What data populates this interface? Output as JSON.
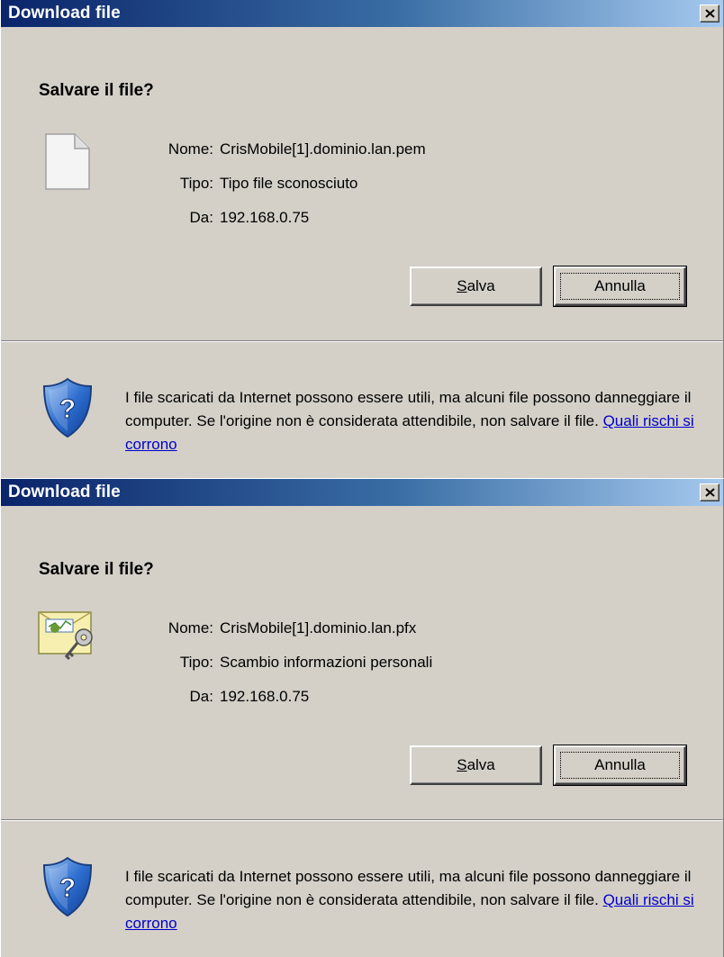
{
  "dialogs": [
    {
      "title": "Download file",
      "question": "Salvare il file?",
      "fields": [
        {
          "label": "Nome:",
          "value": "CrisMobile[1].dominio.lan.pem"
        },
        {
          "label": "Tipo:",
          "value": "Tipo file sconosciuto"
        },
        {
          "label": "Da:",
          "value": "192.168.0.75"
        }
      ],
      "file_icon": "blank-document-icon",
      "save_button": {
        "accel": "S",
        "rest": "alva"
      },
      "cancel_button": "Annulla",
      "warning_text": "I file scaricati da Internet possono essere utili, ma alcuni file possono danneggiare il computer. Se l'origine non è considerata attendibile, non salvare il file.",
      "warning_link": "Quali rischi si corrono",
      "close_label": "×"
    },
    {
      "title": "Download file",
      "question": "Salvare il file?",
      "fields": [
        {
          "label": "Nome:",
          "value": "CrisMobile[1].dominio.lan.pfx"
        },
        {
          "label": "Tipo:",
          "value": "Scambio informazioni personali"
        },
        {
          "label": "Da:",
          "value": "192.168.0.75"
        }
      ],
      "file_icon": "certificate-key-icon",
      "save_button": {
        "accel": "S",
        "rest": "alva"
      },
      "cancel_button": "Annulla",
      "warning_text": "I file scaricati da Internet possono essere utili, ma alcuni file possono danneggiare il computer. Se l'origine non è considerata attendibile, non salvare il file.",
      "warning_link": "Quali rischi si corrono",
      "close_label": "×"
    }
  ],
  "colors": {
    "titlebar_start": "#0a246a",
    "titlebar_end": "#a6caf0",
    "dialog_bg": "#d4d0c8",
    "link": "#0000cc"
  }
}
